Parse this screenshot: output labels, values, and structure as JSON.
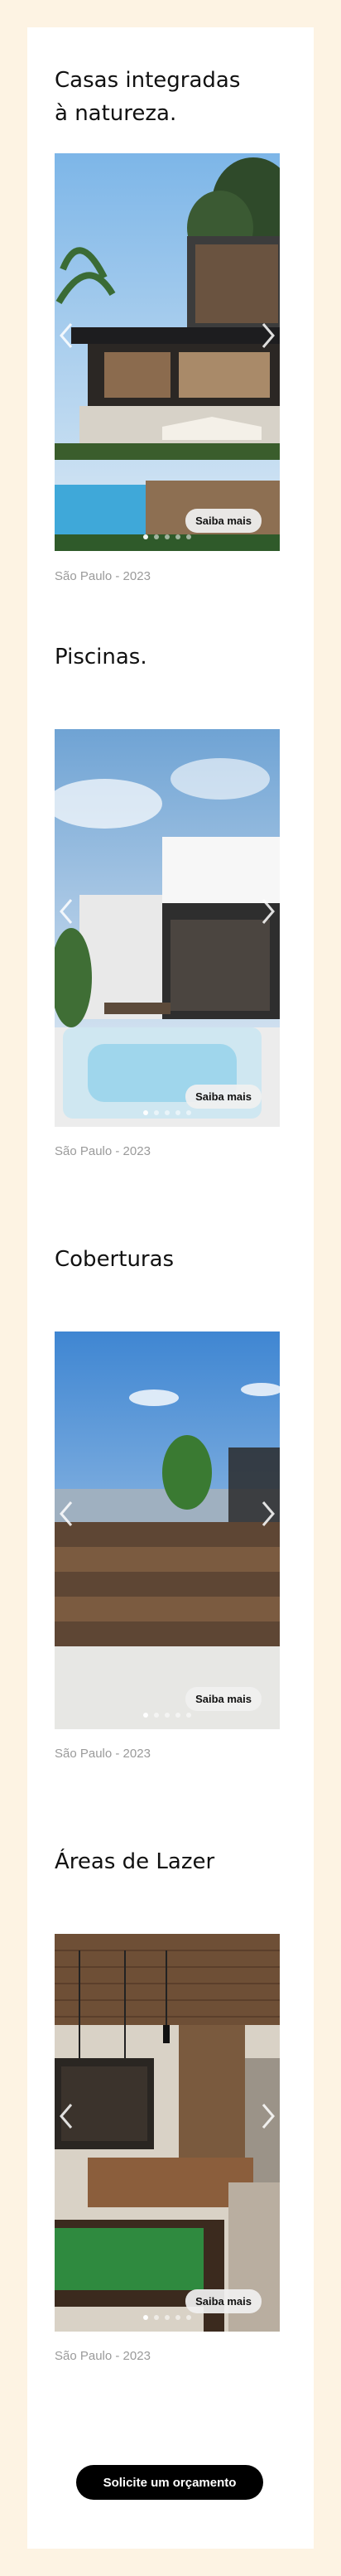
{
  "projects": [
    {
      "title": "Casas integradas\nà natureza.",
      "cta_label": "Saiba mais",
      "caption": "São Paulo - 2023",
      "image_icon": "modern-house-photo"
    },
    {
      "title": "Piscinas.",
      "cta_label": "Saiba mais",
      "caption": "São Paulo - 2023",
      "image_icon": "jacuzzi-terrace-photo"
    },
    {
      "title": "Coberturas",
      "cta_label": "Saiba mais",
      "caption": "São Paulo - 2023",
      "image_icon": "rooftop-deck-photo"
    },
    {
      "title": "Áreas de Lazer",
      "cta_label": "Saiba mais",
      "caption": "São Paulo - 2023",
      "image_icon": "game-room-photo"
    }
  ],
  "carousel": {
    "prev_icon": "chevron-left-icon",
    "next_icon": "chevron-right-icon",
    "dots": 5,
    "active_dot": 1
  },
  "footer": {
    "cta_label": "Solicite um orçamento"
  },
  "colors": {
    "background": "#fdf3e3",
    "card": "#ffffff",
    "cta": "#000000",
    "caption": "#9a9a9a"
  }
}
